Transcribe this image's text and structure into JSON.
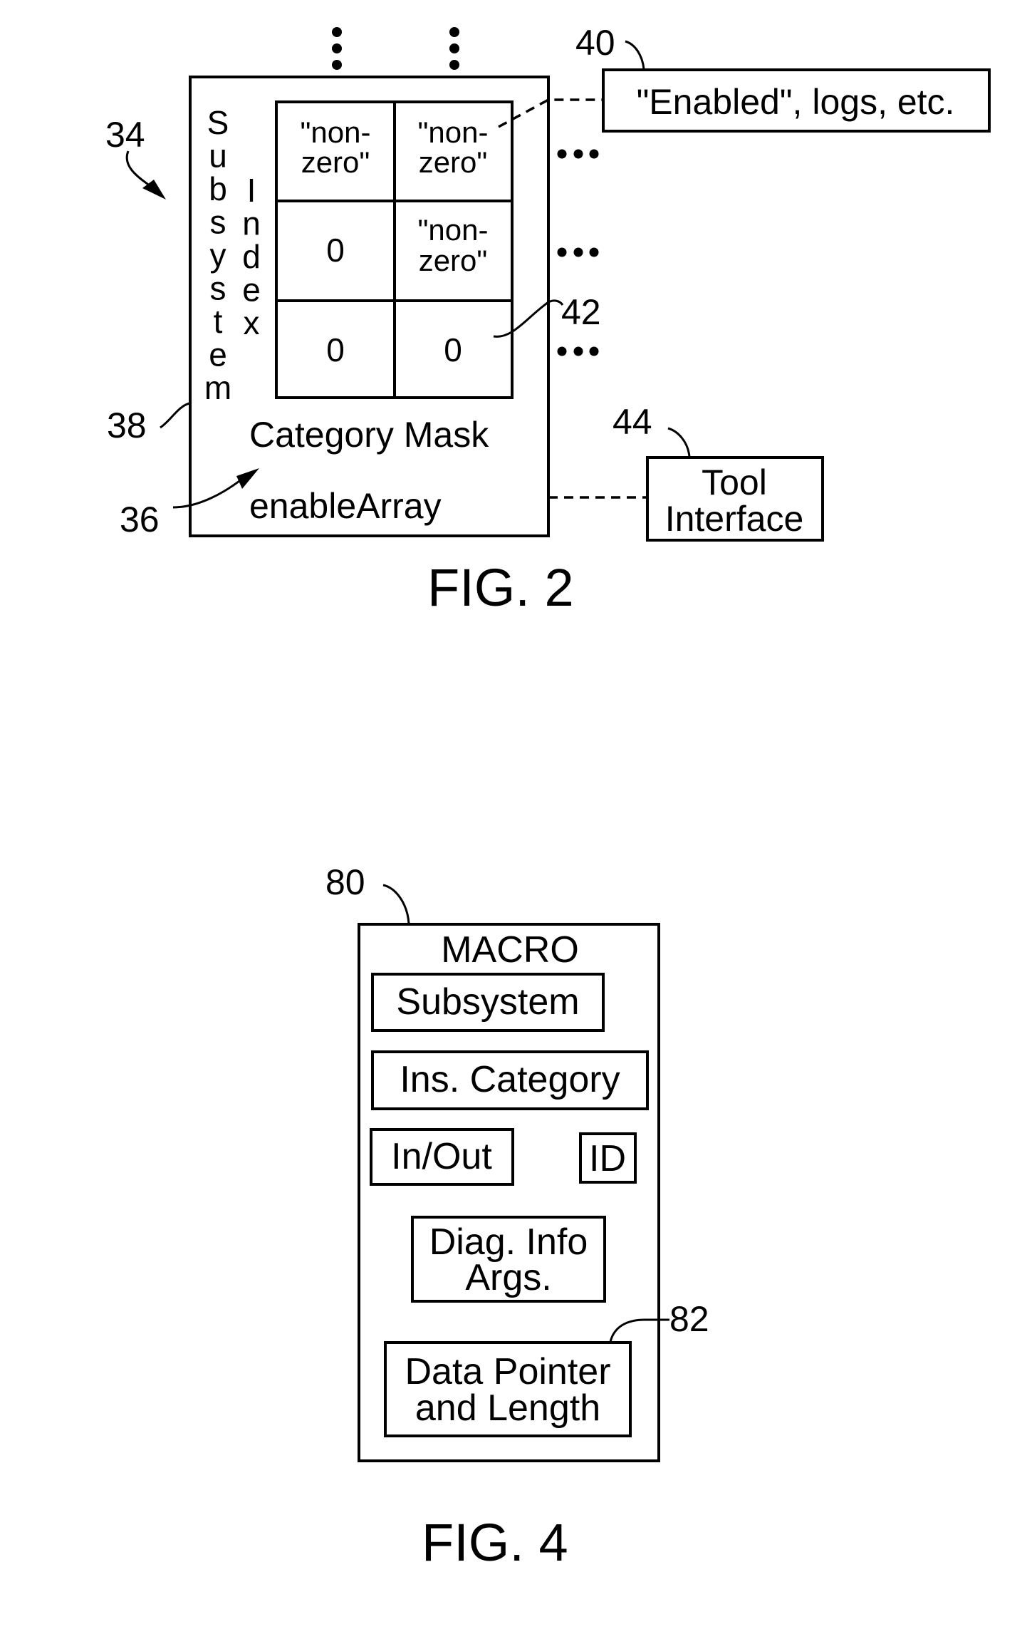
{
  "fig2": {
    "caption": "FIG. 2",
    "ref_labels": {
      "array": "34",
      "enable_array": "36",
      "outer_box": "38",
      "state_box": "40",
      "cell": "42",
      "tool_interface": "44"
    },
    "vertical_labels": {
      "subsystem": [
        "S",
        "u",
        "b",
        "s",
        "y",
        "s",
        "t",
        "e",
        "m"
      ],
      "index": [
        "I",
        "n",
        "d",
        "e",
        "x"
      ]
    },
    "grid": {
      "rows": [
        [
          [
            "\"non-",
            "zero\""
          ],
          [
            "\"non-",
            "zero\""
          ]
        ],
        [
          [
            "0"
          ],
          [
            "\"non-",
            "zero\""
          ]
        ],
        [
          [
            "0"
          ],
          [
            "0"
          ]
        ]
      ],
      "continuation": "..."
    },
    "category_mask_label": "Category Mask",
    "enable_array_label": "enableArray",
    "state_box_text": "\"Enabled\", logs, etc.",
    "tool_interface_lines": [
      "Tool",
      "Interface"
    ]
  },
  "fig4": {
    "caption": "FIG. 4",
    "ref_labels": {
      "macro": "80",
      "data_pointer": "82"
    },
    "title": "MACRO",
    "fields": {
      "subsystem": "Subsystem",
      "ins_category": "Ins. Category",
      "in_out": "In/Out",
      "id": "ID",
      "diag_info": [
        "Diag. Info",
        "Args."
      ],
      "data_pointer": [
        "Data Pointer",
        "and Length"
      ]
    }
  }
}
